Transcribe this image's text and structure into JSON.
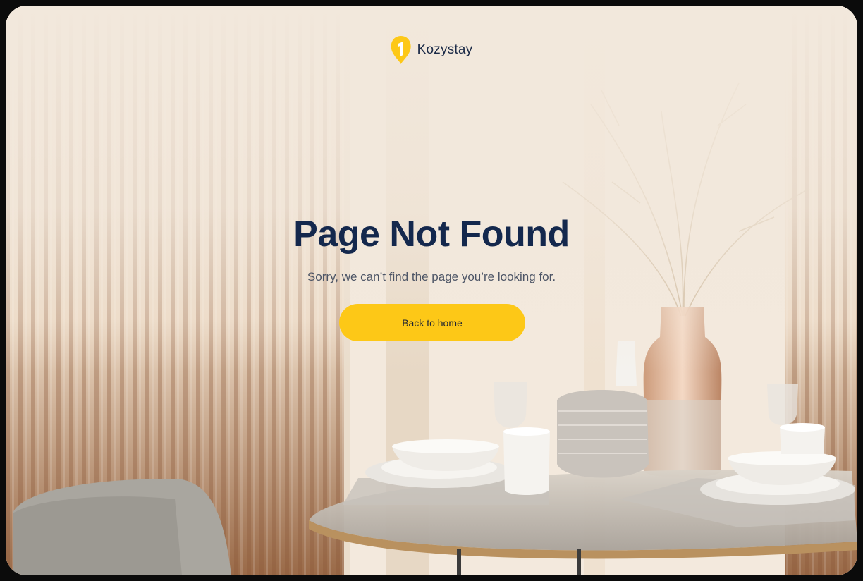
{
  "brand": {
    "name": "Kozystay",
    "logo_icon": "kozystay-pin-logo"
  },
  "error": {
    "title": "Page Not Found",
    "message": "Sorry, we can’t find the page you’re looking for."
  },
  "actions": {
    "back_home_label": "Back to home"
  },
  "colors": {
    "accent": "#FDC817",
    "title": "#14284D",
    "text": "#4D5566",
    "background": "#F2E8DC"
  }
}
